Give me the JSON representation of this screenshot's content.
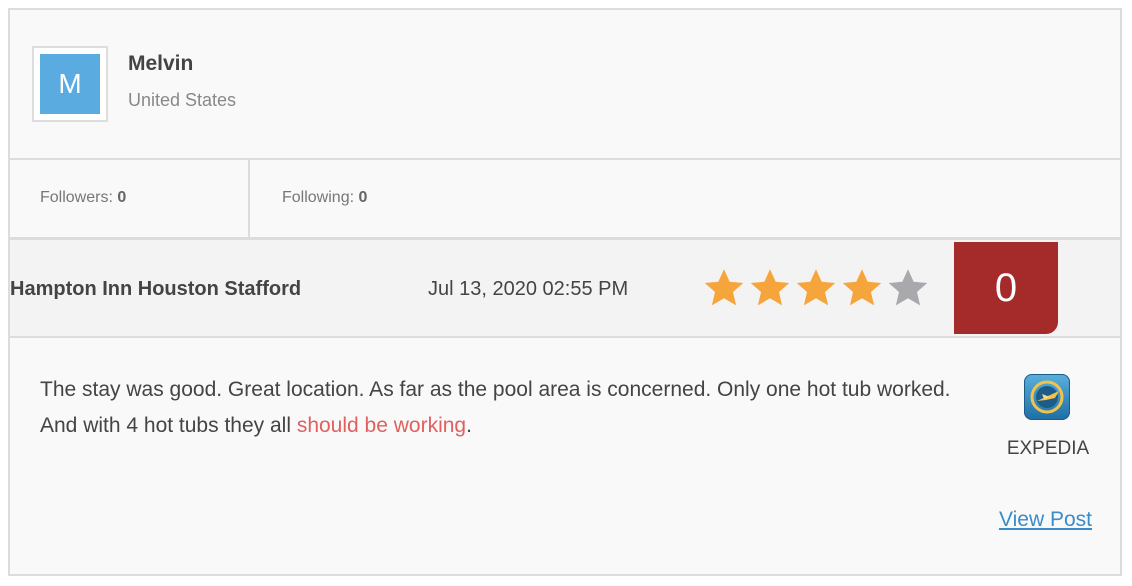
{
  "user": {
    "avatar_letter": "M",
    "name": "Melvin",
    "country": "United States"
  },
  "stats": {
    "followers_label": "Followers:",
    "followers_count": "0",
    "following_label": "Following:",
    "following_count": "0"
  },
  "review": {
    "hotel": "Hampton Inn Houston Stafford",
    "date": "Jul 13, 2020 02:55 PM",
    "rating": 4,
    "rating_max": 5,
    "score": "0",
    "text_part1": "The stay was good. Great location. As far as the pool area is concerned. Only one hot tub worked. And with 4 hot tubs they all ",
    "text_highlight": "should be working",
    "text_part2": ".",
    "source_icon": "expedia-logo-icon",
    "source_name": "EXPEDIA",
    "view_post_label": "View Post"
  },
  "colors": {
    "star_filled": "#f5a53c",
    "star_empty": "#a8a8ad",
    "score_bg": "#a52a2a",
    "avatar_bg": "#5aace0",
    "link": "#3a8cc8",
    "highlight": "#e06060"
  }
}
